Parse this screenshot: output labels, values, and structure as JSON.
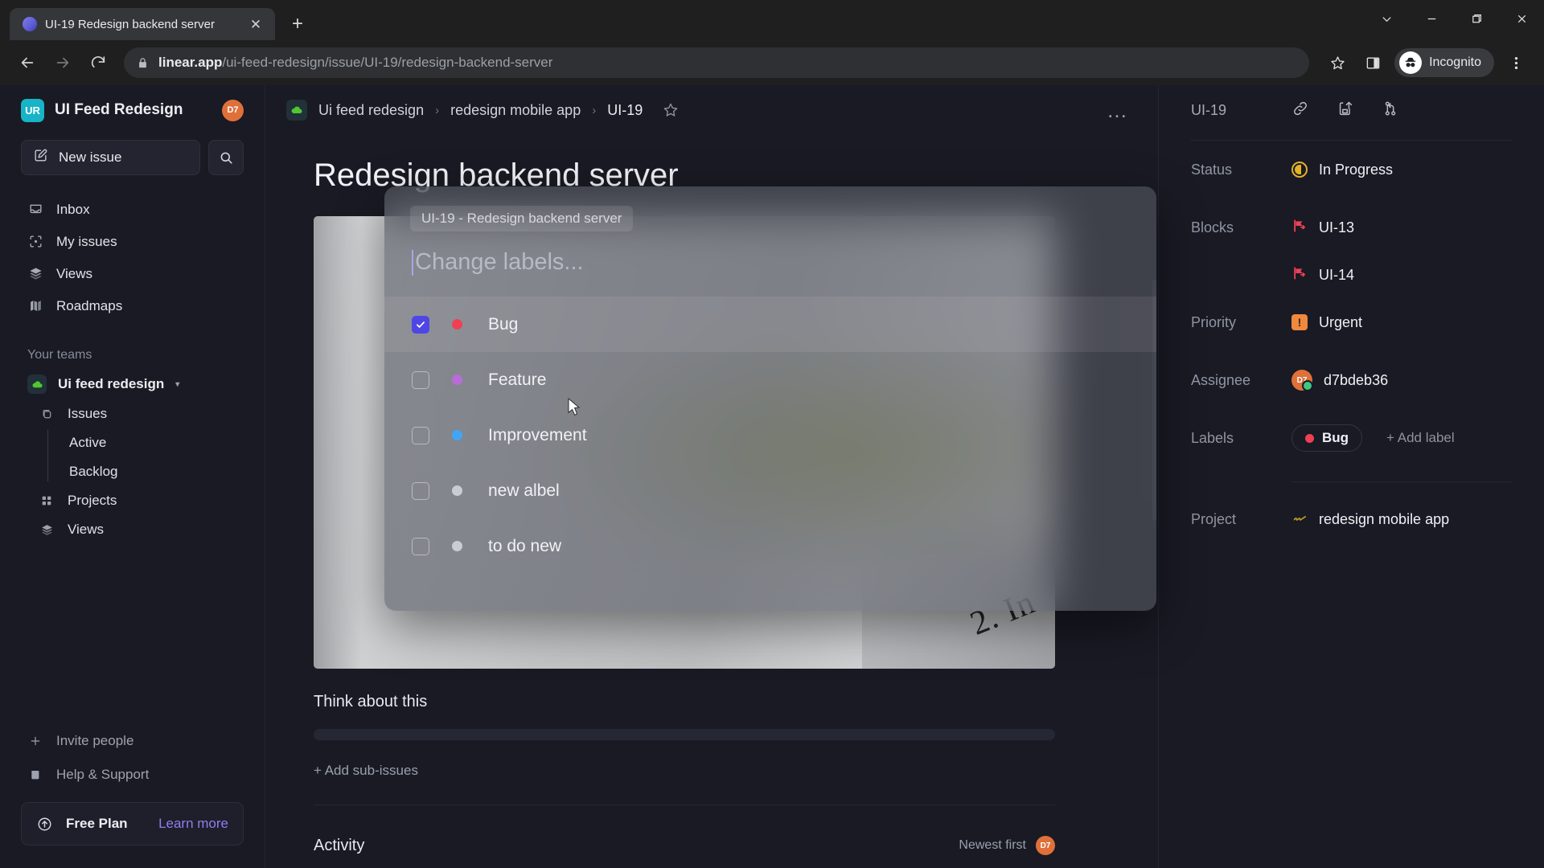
{
  "browser": {
    "tab": {
      "title": "UI-19 Redesign backend server",
      "favicon": "linear-logo-icon",
      "close": "✕"
    },
    "new_tab_label": "+",
    "window_controls": [
      "chevron-down",
      "minimize",
      "maximize",
      "close"
    ],
    "url": {
      "host": "linear.app",
      "path": "/ui-feed-redesign/issue/UI-19/redesign-backend-server"
    },
    "profile_label": "Incognito",
    "icons": [
      "back-arrow",
      "forward-arrow",
      "reload",
      "lock",
      "bookmark-star",
      "side-panel",
      "incognito-avatar",
      "kebab-menu"
    ]
  },
  "sidebar": {
    "workspace": {
      "badge": "UR",
      "name": "UI Feed Redesign",
      "avatar": "D7"
    },
    "new_issue_label": "New issue",
    "search_placeholder": "Search",
    "nav": [
      {
        "label": "Inbox",
        "icon": "inbox-icon"
      },
      {
        "label": "My issues",
        "icon": "my-issues-icon"
      },
      {
        "label": "Views",
        "icon": "views-icon"
      },
      {
        "label": "Roadmaps",
        "icon": "roadmaps-icon"
      }
    ],
    "teams_heading": "Your teams",
    "team": {
      "name": "Ui feed redesign",
      "icon": "team-cloud-icon",
      "caret": "▾"
    },
    "team_children": [
      {
        "label": "Issues",
        "icon": "issues-icon",
        "type": "item"
      },
      {
        "label": "Active",
        "type": "leaf"
      },
      {
        "label": "Backlog",
        "type": "leaf"
      },
      {
        "label": "Projects",
        "icon": "projects-icon",
        "type": "item"
      },
      {
        "label": "Views",
        "icon": "views-icon",
        "type": "item"
      }
    ],
    "bottom": [
      {
        "label": "Invite people",
        "icon": "plus-icon"
      },
      {
        "label": "Help & Support",
        "icon": "book-icon"
      }
    ],
    "plan": {
      "name": "Free Plan",
      "link": "Learn more",
      "icon": "upgrade-arrow-icon"
    }
  },
  "main_header": {
    "breadcrumb": [
      {
        "label": "Ui feed redesign"
      },
      {
        "label": "redesign mobile app"
      },
      {
        "label": "UI-19"
      }
    ],
    "separator": "›",
    "star": "☆",
    "more": "…"
  },
  "issue": {
    "title": "Redesign backend server",
    "photo_text": "2. In",
    "description_heading": "Think about this",
    "add_sub_issues": "+ Add sub-issues",
    "activity_heading": "Activity",
    "activity_filter": "Newest first",
    "activity_avatar": "D7"
  },
  "modal": {
    "context_chip": "UI-19 - Redesign backend server",
    "input_placeholder": "Change labels...",
    "input_value": "",
    "labels": [
      {
        "name": "Bug",
        "color": "#ef4054",
        "checked": true
      },
      {
        "name": "Feature",
        "color": "#bb6bd9",
        "checked": false
      },
      {
        "name": "Improvement",
        "color": "#41a5f5",
        "checked": false
      },
      {
        "name": "new albel",
        "color": "#c9ccd3",
        "checked": false
      },
      {
        "name": "to do new",
        "color": "#c9ccd3",
        "checked": false
      }
    ]
  },
  "properties": {
    "issue_id": "UI-19",
    "header_actions": [
      "copy-link-icon",
      "copy-clipboard-icon",
      "branch-icon"
    ],
    "status": {
      "label": "Status",
      "value": "In Progress",
      "color": "#e2b227"
    },
    "blocks": {
      "label": "Blocks",
      "values": [
        "UI-13",
        "UI-14"
      ],
      "color": "#ef4054"
    },
    "priority": {
      "label": "Priority",
      "value": "Urgent",
      "color": "#f0883e"
    },
    "assignee": {
      "label": "Assignee",
      "value": "d7bdeb36",
      "avatar": "D7"
    },
    "labels": {
      "label": "Labels",
      "chip": "Bug",
      "chip_color": "#ef4054",
      "add": "+ Add label"
    },
    "project": {
      "label": "Project",
      "value": "redesign mobile app",
      "color": "#b5932a"
    }
  }
}
